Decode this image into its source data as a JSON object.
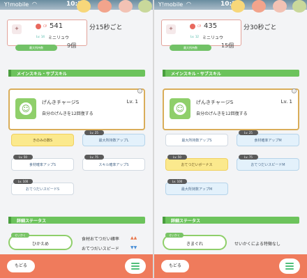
{
  "colors": {
    "accent": "#6cc35c",
    "bottom_bar": "#ef7b5c",
    "gold": "#fbe98d"
  },
  "panels": [
    {
      "status": {
        "carrier": "Y!mobile",
        "time": "10:22"
      },
      "header": {
        "cp_label": "CP",
        "cp": "541",
        "level": "Lv. 14",
        "name": "ミニリュウ",
        "behind_text": "分15秒ごと",
        "count": "9個",
        "button": "最大所持数"
      },
      "main_skill_section": "メインスキル・サブスキル",
      "main_skill": {
        "name": "げんきチャージS",
        "level": "Lv. 1",
        "desc": "自分のげんきを12回復する"
      },
      "subskills": [
        {
          "label": "きのみの数S",
          "lv": "",
          "style": "gold"
        },
        {
          "label": "最大所持数アップL",
          "lv": "Lv. 25",
          "style": "blue"
        },
        {
          "label": "食材確率アップS",
          "lv": "Lv. 50",
          "style": "white"
        },
        {
          "label": "スキル確率アップS",
          "lv": "Lv. 75",
          "style": "white"
        },
        {
          "label": "おてつだいスピードS",
          "lv": "Lv. 100",
          "style": "white"
        }
      ],
      "status_section": "詳細ステータス",
      "nature": {
        "tag": "せいかく",
        "value": "ひかえめ"
      },
      "nature_lines": [
        "食材おてつだい確率",
        "おてつだいスピード"
      ],
      "nav": {
        "back": "もどる"
      }
    },
    {
      "status": {
        "carrier": "Y!mobile",
        "time": "10:22"
      },
      "header": {
        "cp_label": "CP",
        "cp": "435",
        "level": "Lv. 12",
        "name": "ミニリュウ",
        "behind_text": "分30秒ごと",
        "count": "15個",
        "button": "最大所持数"
      },
      "main_skill_section": "メインスキル・サブスキル",
      "main_skill": {
        "name": "げんきチャージS",
        "level": "Lv. 1",
        "desc": "自分のげんきを12回復する"
      },
      "subskills": [
        {
          "label": "最大所持数アップS",
          "lv": "",
          "style": "white"
        },
        {
          "label": "食材確率アップM",
          "lv": "Lv. 25",
          "style": "blue"
        },
        {
          "label": "おてつだいボーナス",
          "lv": "Lv. 50",
          "style": "gold"
        },
        {
          "label": "おてつだいスピードM",
          "lv": "Lv. 75",
          "style": "blue"
        },
        {
          "label": "最大所持数アップM",
          "lv": "Lv. 100",
          "style": "blue"
        }
      ],
      "status_section": "詳細ステータス",
      "nature": {
        "tag": "せいかく",
        "value": "きまぐれ"
      },
      "nature_lines": [
        "せいかくによる特徴なし"
      ],
      "nav": {
        "back": "もどる"
      }
    }
  ]
}
